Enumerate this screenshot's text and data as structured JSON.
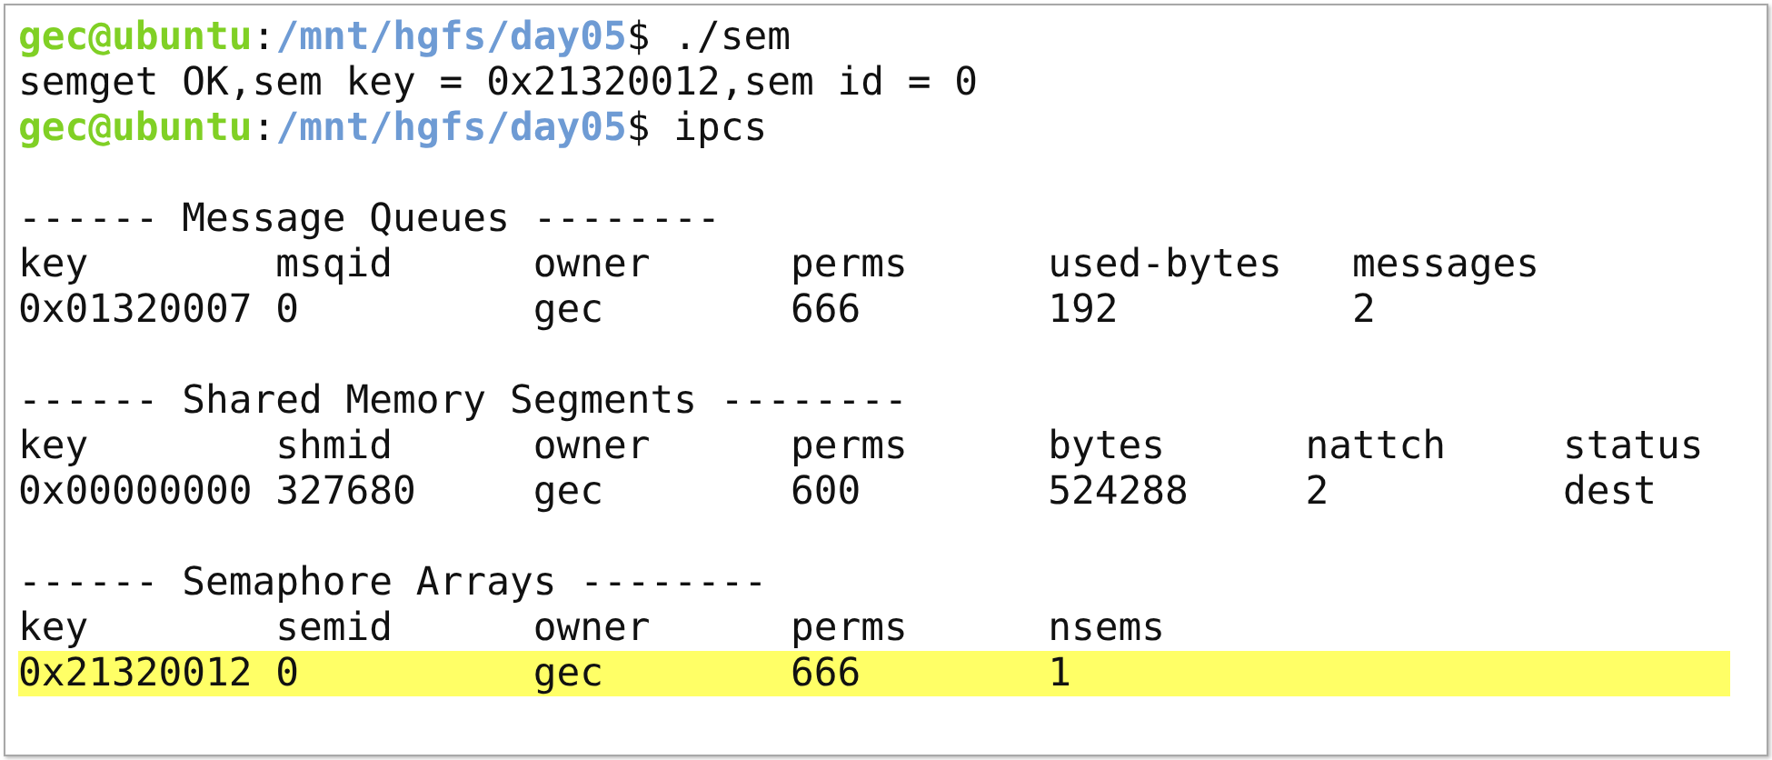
{
  "terminal": {
    "lines": [
      {
        "kind": "prompt",
        "user_host": "gec@ubuntu",
        "separator": ":",
        "path": "/mnt/hgfs/day05",
        "command": "$ ./sem"
      },
      {
        "kind": "output",
        "text": "semget OK,sem key = 0x21320012,sem id = 0"
      },
      {
        "kind": "prompt",
        "user_host": "gec@ubuntu",
        "separator": ":",
        "path": "/mnt/hgfs/day05",
        "command": "$ ipcs"
      }
    ],
    "sections": [
      {
        "kind": "message_queues",
        "heading": "------ Message Queues --------",
        "columns": [
          "key",
          "msqid",
          "owner",
          "perms",
          "used-bytes",
          "messages"
        ],
        "rows": [
          {
            "highlighted": false,
            "cells": [
              "0x01320007",
              "0",
              "gec",
              "666",
              "192",
              "2"
            ]
          }
        ]
      },
      {
        "kind": "shared_memory",
        "heading": "------ Shared Memory Segments --------",
        "columns": [
          "key",
          "shmid",
          "owner",
          "perms",
          "bytes",
          "nattch",
          "status"
        ],
        "rows": [
          {
            "highlighted": false,
            "cells": [
              "0x00000000",
              "327680",
              "gec",
              "600",
              "524288",
              "2",
              "dest"
            ]
          }
        ]
      },
      {
        "kind": "semaphores",
        "heading": "------ Semaphore Arrays --------",
        "columns": [
          "key",
          "semid",
          "owner",
          "perms",
          "nsems"
        ],
        "rows": [
          {
            "highlighted": true,
            "cells": [
              "0x21320012",
              "0",
              "gec",
              "666",
              "1"
            ]
          }
        ]
      }
    ]
  }
}
